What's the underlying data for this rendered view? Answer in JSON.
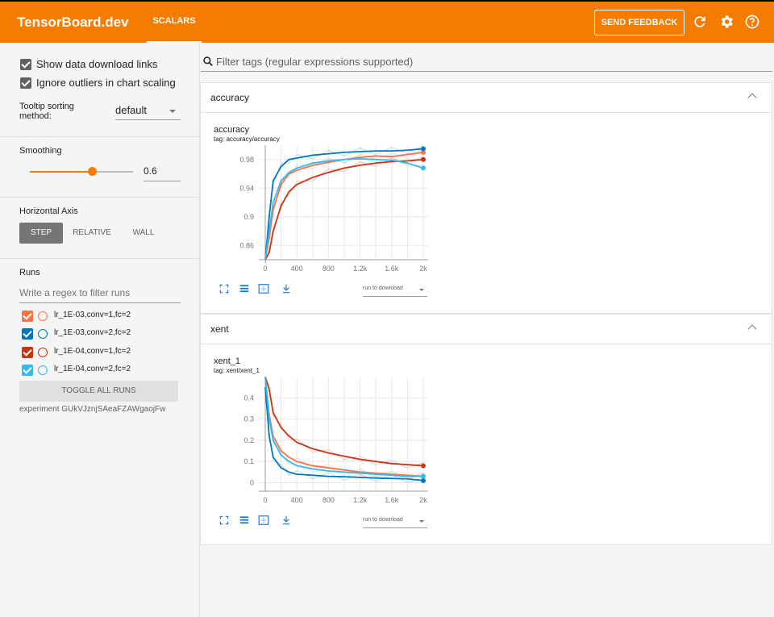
{
  "header": {
    "brand": "TensorBoard.dev",
    "tab": "SCALARS",
    "feedback": "SEND FEEDBACK",
    "icons": [
      "refresh-icon",
      "settings-icon",
      "help-icon"
    ]
  },
  "sidebar": {
    "show_download": "Show data download links",
    "ignore_outliers": "Ignore outliers in chart scaling",
    "tooltip_label": "Tooltip sorting method:",
    "tooltip_value": "default",
    "smoothing_title": "Smoothing",
    "smoothing_value": "0.6",
    "smoothing_fraction": 0.6,
    "haxis_title": "Horizontal Axis",
    "haxis_options": [
      "STEP",
      "RELATIVE",
      "WALL"
    ],
    "haxis_selected": "STEP",
    "runs_title": "Runs",
    "runs_filter_placeholder": "Write a regex to filter runs",
    "runs": [
      {
        "name": "lr_1E-03,conv=1,fc=2",
        "color": "#ff7043"
      },
      {
        "name": "lr_1E-03,conv=2,fc=2",
        "color": "#0077bb"
      },
      {
        "name": "lr_1E-04,conv=1,fc=2",
        "color": "#cc3311"
      },
      {
        "name": "lr_1E-04,conv=2,fc=2",
        "color": "#33bbee"
      }
    ],
    "toggle_all": "TOGGLE ALL RUNS",
    "experiment": "experiment GUkVJznjSAeaFZAWgaojFw"
  },
  "main": {
    "search_placeholder": "Filter tags (regular expressions supported)",
    "groups": [
      {
        "name": "accuracy",
        "card_title": "accuracy",
        "card_tag": "tag: accuracy/accuracy",
        "download_label": "run to download"
      },
      {
        "name": "xent",
        "card_title": "xent_1",
        "card_tag": "tag: xent/xent_1",
        "download_label": "run to download"
      }
    ]
  },
  "chart_data": [
    {
      "type": "line",
      "title": "accuracy",
      "x_ticks": [
        "0",
        "400",
        "800",
        "1.2k",
        "1.6k",
        "2k"
      ],
      "y_ticks": [
        "0.86",
        "0.9",
        "0.94",
        "0.98"
      ],
      "xlim": [
        0,
        2000
      ],
      "ylim": [
        0.84,
        1.0
      ],
      "grid": true,
      "series": [
        {
          "name": "lr_1E-03,conv=1,fc=2",
          "color": "#ff7043",
          "x": [
            0,
            50,
            100,
            200,
            300,
            400,
            600,
            800,
            1000,
            1200,
            1400,
            1600,
            1800,
            2000
          ],
          "y": [
            0.84,
            0.87,
            0.91,
            0.945,
            0.96,
            0.965,
            0.972,
            0.976,
            0.98,
            0.983,
            0.985,
            0.984,
            0.987,
            0.99
          ]
        },
        {
          "name": "lr_1E-03,conv=2,fc=2",
          "color": "#0077bb",
          "x": [
            0,
            50,
            100,
            200,
            300,
            400,
            600,
            800,
            1000,
            1200,
            1400,
            1600,
            1800,
            2000
          ],
          "y": [
            0.84,
            0.9,
            0.95,
            0.97,
            0.98,
            0.982,
            0.986,
            0.988,
            0.99,
            0.991,
            0.992,
            0.992,
            0.993,
            0.995
          ]
        },
        {
          "name": "lr_1E-04,conv=1,fc=2",
          "color": "#cc3311",
          "x": [
            0,
            50,
            100,
            200,
            300,
            400,
            600,
            800,
            1000,
            1200,
            1400,
            1600,
            1800,
            2000
          ],
          "y": [
            0.84,
            0.85,
            0.88,
            0.915,
            0.935,
            0.945,
            0.955,
            0.962,
            0.968,
            0.972,
            0.975,
            0.977,
            0.978,
            0.98
          ]
        },
        {
          "name": "lr_1E-04,conv=2,fc=2",
          "color": "#33bbee",
          "x": [
            0,
            50,
            100,
            200,
            300,
            400,
            600,
            800,
            1000,
            1200,
            1400,
            1600,
            1800,
            2000
          ],
          "y": [
            0.84,
            0.88,
            0.92,
            0.95,
            0.962,
            0.968,
            0.975,
            0.978,
            0.98,
            0.981,
            0.98,
            0.979,
            0.975,
            0.968
          ]
        }
      ]
    },
    {
      "type": "line",
      "title": "xent_1",
      "x_ticks": [
        "0",
        "400",
        "800",
        "1.2k",
        "1.6k",
        "2k"
      ],
      "y_ticks": [
        "0",
        "0.1",
        "0.2",
        "0.3",
        "0.4"
      ],
      "xlim": [
        0,
        2000
      ],
      "ylim": [
        -0.04,
        0.5
      ],
      "grid": true,
      "series": [
        {
          "name": "lr_1E-03,conv=1,fc=2",
          "color": "#ff7043",
          "x": [
            0,
            50,
            100,
            200,
            300,
            400,
            600,
            800,
            1000,
            1200,
            1400,
            1600,
            1800,
            2000
          ],
          "y": [
            0.5,
            0.32,
            0.22,
            0.15,
            0.12,
            0.1,
            0.08,
            0.07,
            0.06,
            0.05,
            0.045,
            0.04,
            0.035,
            0.03
          ]
        },
        {
          "name": "lr_1E-03,conv=2,fc=2",
          "color": "#0077bb",
          "x": [
            0,
            50,
            100,
            200,
            300,
            400,
            600,
            800,
            1000,
            1200,
            1400,
            1600,
            1800,
            2000
          ],
          "y": [
            0.45,
            0.22,
            0.12,
            0.07,
            0.05,
            0.04,
            0.035,
            0.03,
            0.028,
            0.025,
            0.022,
            0.02,
            0.018,
            0.01
          ]
        },
        {
          "name": "lr_1E-04,conv=1,fc=2",
          "color": "#cc3311",
          "x": [
            0,
            50,
            100,
            200,
            300,
            400,
            600,
            800,
            1000,
            1200,
            1400,
            1600,
            1800,
            2000
          ],
          "y": [
            0.5,
            0.44,
            0.33,
            0.26,
            0.22,
            0.19,
            0.16,
            0.14,
            0.125,
            0.11,
            0.1,
            0.09,
            0.085,
            0.08
          ]
        },
        {
          "name": "lr_1E-04,conv=2,fc=2",
          "color": "#33bbee",
          "x": [
            0,
            50,
            100,
            200,
            300,
            400,
            600,
            800,
            1000,
            1200,
            1400,
            1600,
            1800,
            2000
          ],
          "y": [
            0.5,
            0.3,
            0.2,
            0.13,
            0.1,
            0.08,
            0.065,
            0.055,
            0.05,
            0.045,
            0.04,
            0.035,
            0.03,
            0.03
          ]
        }
      ]
    }
  ]
}
